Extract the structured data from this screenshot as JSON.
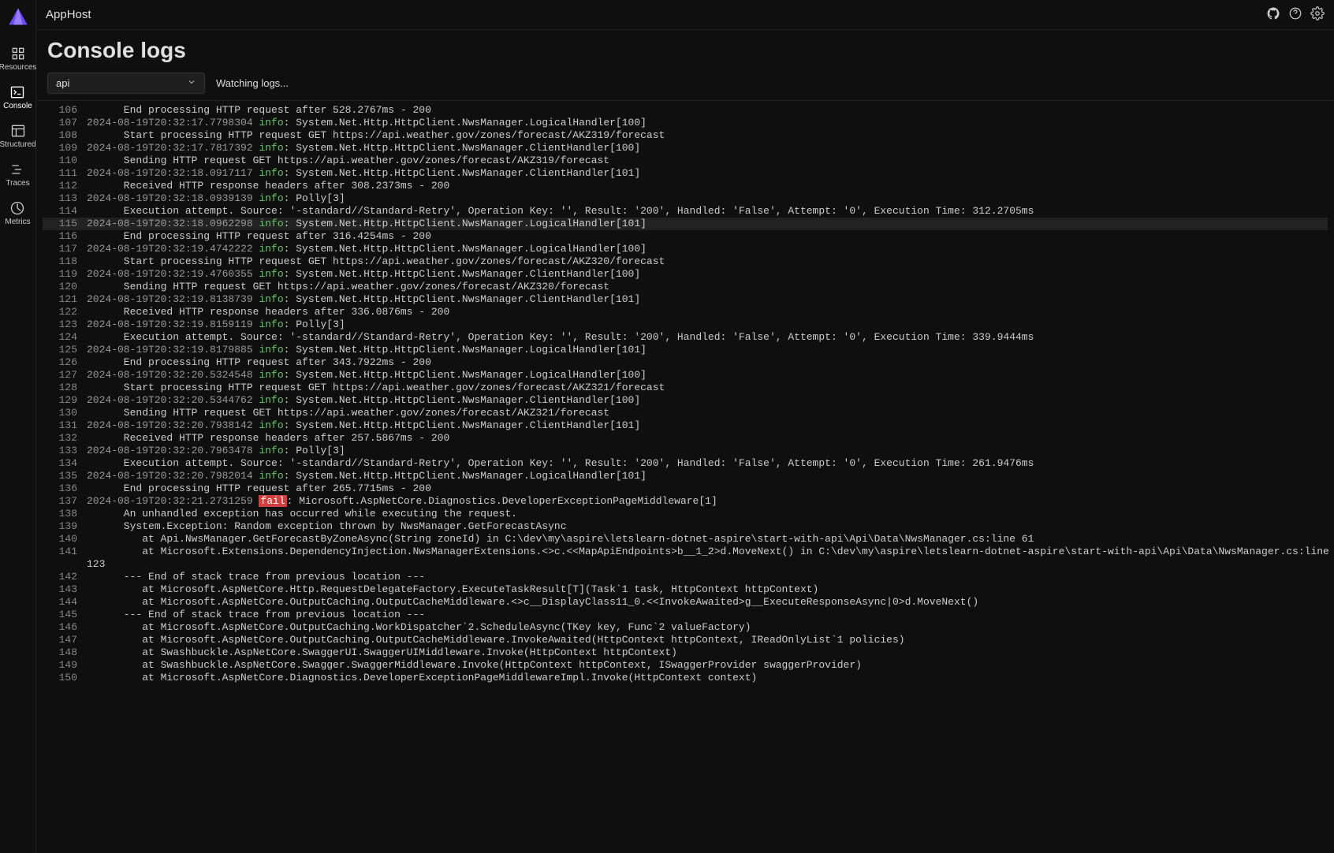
{
  "app_title": "AppHost",
  "sidebar": {
    "items": [
      {
        "label": "Resources"
      },
      {
        "label": "Console"
      },
      {
        "label": "Structured"
      },
      {
        "label": "Traces"
      },
      {
        "label": "Metrics"
      }
    ]
  },
  "page_title": "Console logs",
  "dropdown_value": "api",
  "status_text": "Watching logs...",
  "highlight_line": 115,
  "logs": [
    {
      "n": 106,
      "indent": 6,
      "msg": "End processing HTTP request after 528.2767ms - 200"
    },
    {
      "n": 107,
      "ts": "2024-08-19T20:32:17.7798304",
      "lvl": "info",
      "src": "System.Net.Http.HttpClient.NwsManager.LogicalHandler[100]"
    },
    {
      "n": 108,
      "indent": 6,
      "msg": "Start processing HTTP request GET https://api.weather.gov/zones/forecast/AKZ319/forecast"
    },
    {
      "n": 109,
      "ts": "2024-08-19T20:32:17.7817392",
      "lvl": "info",
      "src": "System.Net.Http.HttpClient.NwsManager.ClientHandler[100]"
    },
    {
      "n": 110,
      "indent": 6,
      "msg": "Sending HTTP request GET https://api.weather.gov/zones/forecast/AKZ319/forecast"
    },
    {
      "n": 111,
      "ts": "2024-08-19T20:32:18.0917117",
      "lvl": "info",
      "src": "System.Net.Http.HttpClient.NwsManager.ClientHandler[101]"
    },
    {
      "n": 112,
      "indent": 6,
      "msg": "Received HTTP response headers after 308.2373ms - 200"
    },
    {
      "n": 113,
      "ts": "2024-08-19T20:32:18.0939139",
      "lvl": "info",
      "src": "Polly[3]"
    },
    {
      "n": 114,
      "indent": 6,
      "msg": "Execution attempt. Source: '-standard//Standard-Retry', Operation Key: '', Result: '200', Handled: 'False', Attempt: '0', Execution Time: 312.2705ms"
    },
    {
      "n": 115,
      "ts": "2024-08-19T20:32:18.0962298",
      "lvl": "info",
      "src": "System.Net.Http.HttpClient.NwsManager.LogicalHandler[101]"
    },
    {
      "n": 116,
      "indent": 6,
      "msg": "End processing HTTP request after 316.4254ms - 200"
    },
    {
      "n": 117,
      "ts": "2024-08-19T20:32:19.4742222",
      "lvl": "info",
      "src": "System.Net.Http.HttpClient.NwsManager.LogicalHandler[100]"
    },
    {
      "n": 118,
      "indent": 6,
      "msg": "Start processing HTTP request GET https://api.weather.gov/zones/forecast/AKZ320/forecast"
    },
    {
      "n": 119,
      "ts": "2024-08-19T20:32:19.4760355",
      "lvl": "info",
      "src": "System.Net.Http.HttpClient.NwsManager.ClientHandler[100]"
    },
    {
      "n": 120,
      "indent": 6,
      "msg": "Sending HTTP request GET https://api.weather.gov/zones/forecast/AKZ320/forecast"
    },
    {
      "n": 121,
      "ts": "2024-08-19T20:32:19.8138739",
      "lvl": "info",
      "src": "System.Net.Http.HttpClient.NwsManager.ClientHandler[101]"
    },
    {
      "n": 122,
      "indent": 6,
      "msg": "Received HTTP response headers after 336.0876ms - 200"
    },
    {
      "n": 123,
      "ts": "2024-08-19T20:32:19.8159119",
      "lvl": "info",
      "src": "Polly[3]"
    },
    {
      "n": 124,
      "indent": 6,
      "msg": "Execution attempt. Source: '-standard//Standard-Retry', Operation Key: '', Result: '200', Handled: 'False', Attempt: '0', Execution Time: 339.9444ms"
    },
    {
      "n": 125,
      "ts": "2024-08-19T20:32:19.8179885",
      "lvl": "info",
      "src": "System.Net.Http.HttpClient.NwsManager.LogicalHandler[101]"
    },
    {
      "n": 126,
      "indent": 6,
      "msg": "End processing HTTP request after 343.7922ms - 200"
    },
    {
      "n": 127,
      "ts": "2024-08-19T20:32:20.5324548",
      "lvl": "info",
      "src": "System.Net.Http.HttpClient.NwsManager.LogicalHandler[100]"
    },
    {
      "n": 128,
      "indent": 6,
      "msg": "Start processing HTTP request GET https://api.weather.gov/zones/forecast/AKZ321/forecast"
    },
    {
      "n": 129,
      "ts": "2024-08-19T20:32:20.5344762",
      "lvl": "info",
      "src": "System.Net.Http.HttpClient.NwsManager.ClientHandler[100]"
    },
    {
      "n": 130,
      "indent": 6,
      "msg": "Sending HTTP request GET https://api.weather.gov/zones/forecast/AKZ321/forecast"
    },
    {
      "n": 131,
      "ts": "2024-08-19T20:32:20.7938142",
      "lvl": "info",
      "src": "System.Net.Http.HttpClient.NwsManager.ClientHandler[101]"
    },
    {
      "n": 132,
      "indent": 6,
      "msg": "Received HTTP response headers after 257.5867ms - 200"
    },
    {
      "n": 133,
      "ts": "2024-08-19T20:32:20.7963478",
      "lvl": "info",
      "src": "Polly[3]"
    },
    {
      "n": 134,
      "indent": 6,
      "msg": "Execution attempt. Source: '-standard//Standard-Retry', Operation Key: '', Result: '200', Handled: 'False', Attempt: '0', Execution Time: 261.9476ms"
    },
    {
      "n": 135,
      "ts": "2024-08-19T20:32:20.7982014",
      "lvl": "info",
      "src": "System.Net.Http.HttpClient.NwsManager.LogicalHandler[101]"
    },
    {
      "n": 136,
      "indent": 6,
      "msg": "End processing HTTP request after 265.7715ms - 200"
    },
    {
      "n": 137,
      "ts": "2024-08-19T20:32:21.2731259",
      "lvl": "fail",
      "src": "Microsoft.AspNetCore.Diagnostics.DeveloperExceptionPageMiddleware[1]"
    },
    {
      "n": 138,
      "indent": 6,
      "msg": "An unhandled exception has occurred while executing the request."
    },
    {
      "n": 139,
      "indent": 6,
      "msg": "System.Exception: Random exception thrown by NwsManager.GetForecastAsync"
    },
    {
      "n": 140,
      "indent": 9,
      "msg": "at Api.NwsManager.GetForecastByZoneAsync(String zoneId) in C:\\dev\\my\\aspire\\letslearn-dotnet-aspire\\start-with-api\\Api\\Data\\NwsManager.cs:line 61"
    },
    {
      "n": 141,
      "indent": 9,
      "wrap": "123",
      "msg": "at Microsoft.Extensions.DependencyInjection.NwsManagerExtensions.<>c.<<MapApiEndpoints>b__1_2>d.MoveNext() in C:\\dev\\my\\aspire\\letslearn-dotnet-aspire\\start-with-api\\Api\\Data\\NwsManager.cs:line "
    },
    {
      "n": 142,
      "indent": 6,
      "msg": "--- End of stack trace from previous location ---"
    },
    {
      "n": 143,
      "indent": 9,
      "msg": "at Microsoft.AspNetCore.Http.RequestDelegateFactory.ExecuteTaskResult[T](Task`1 task, HttpContext httpContext)"
    },
    {
      "n": 144,
      "indent": 9,
      "msg": "at Microsoft.AspNetCore.OutputCaching.OutputCacheMiddleware.<>c__DisplayClass11_0.<<InvokeAwaited>g__ExecuteResponseAsync|0>d.MoveNext()"
    },
    {
      "n": 145,
      "indent": 6,
      "msg": "--- End of stack trace from previous location ---"
    },
    {
      "n": 146,
      "indent": 9,
      "msg": "at Microsoft.AspNetCore.OutputCaching.WorkDispatcher`2.ScheduleAsync(TKey key, Func`2 valueFactory)"
    },
    {
      "n": 147,
      "indent": 9,
      "msg": "at Microsoft.AspNetCore.OutputCaching.OutputCacheMiddleware.InvokeAwaited(HttpContext httpContext, IReadOnlyList`1 policies)"
    },
    {
      "n": 148,
      "indent": 9,
      "msg": "at Swashbuckle.AspNetCore.SwaggerUI.SwaggerUIMiddleware.Invoke(HttpContext httpContext)"
    },
    {
      "n": 149,
      "indent": 9,
      "msg": "at Swashbuckle.AspNetCore.Swagger.SwaggerMiddleware.Invoke(HttpContext httpContext, ISwaggerProvider swaggerProvider)"
    },
    {
      "n": 150,
      "indent": 9,
      "msg": "at Microsoft.AspNetCore.Diagnostics.DeveloperExceptionPageMiddlewareImpl.Invoke(HttpContext context)"
    }
  ]
}
